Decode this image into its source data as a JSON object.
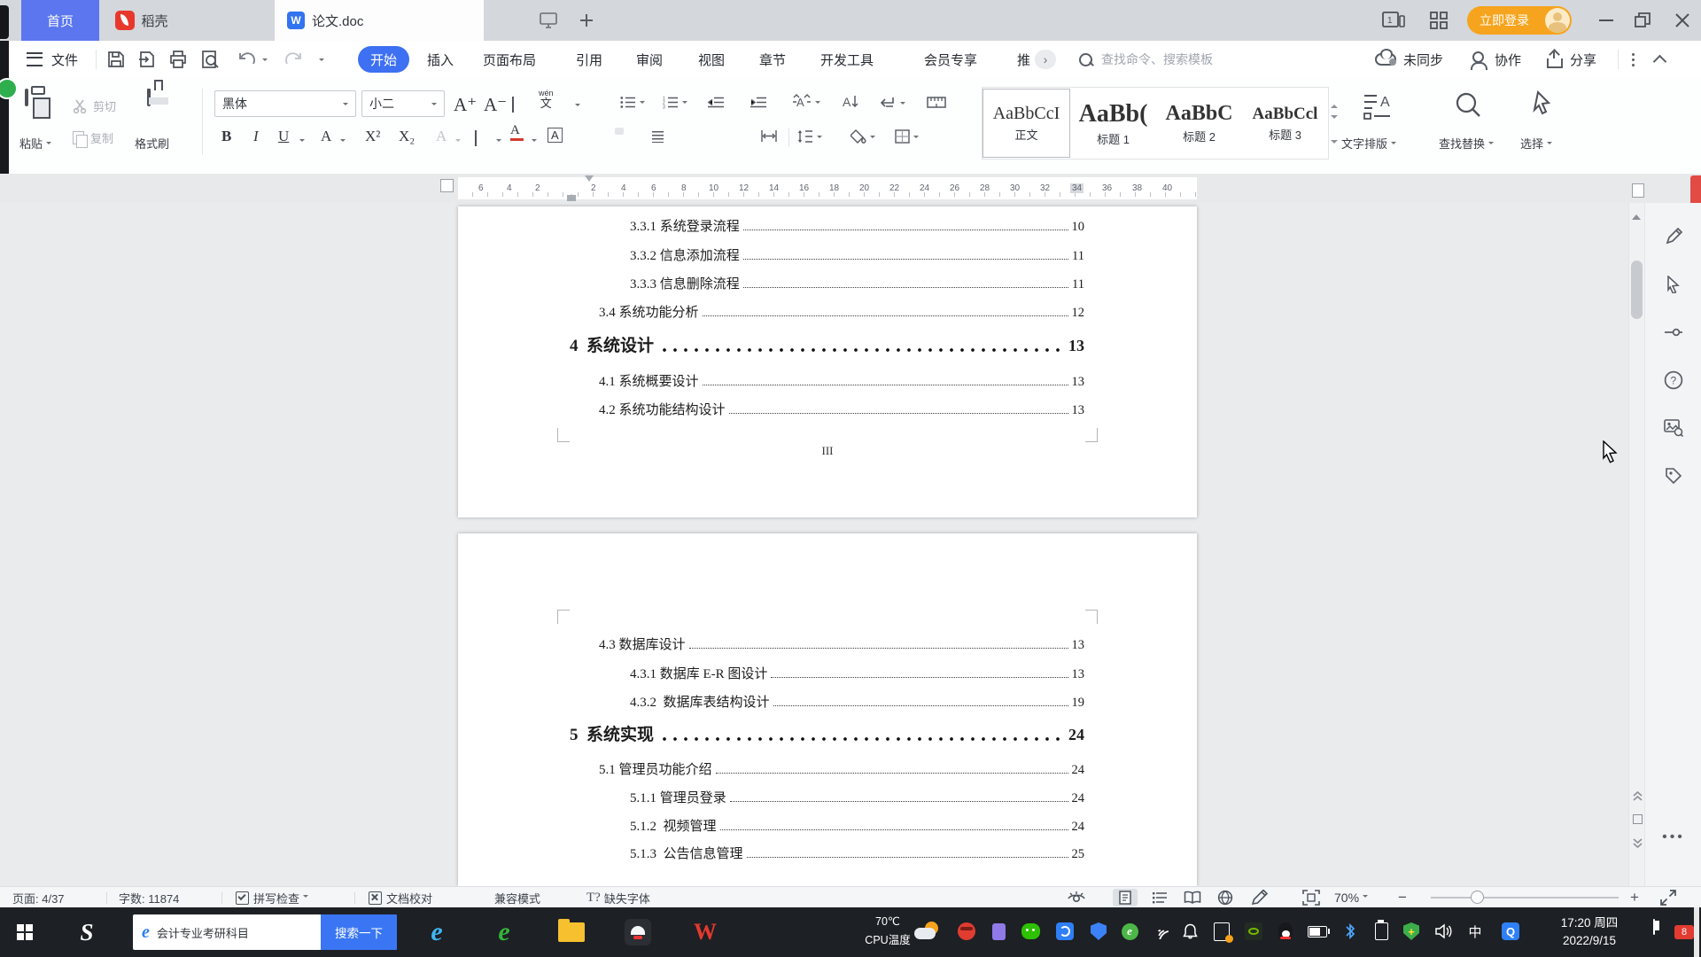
{
  "titlebar": {
    "tab_home": "首页",
    "tab_docer": "稻壳",
    "tab_doc": "论文.doc",
    "login": "立即登录"
  },
  "menubar": {
    "file": "文件",
    "tabs": [
      "开始",
      "插入",
      "页面布局",
      "引用",
      "审阅",
      "视图",
      "章节",
      "开发工具",
      "会员专享",
      "推"
    ],
    "more": "›",
    "search_placeholder": "查找命令、搜索模板",
    "sync": "未同步",
    "collab": "协作",
    "share": "分享"
  },
  "ribbon": {
    "paste": "粘贴",
    "cut": "剪切",
    "copy": "复制",
    "painter": "格式刷",
    "font_name": "黑体",
    "font_size": "小二",
    "bold": "B",
    "italic": "I",
    "underline": "U",
    "accent": "A",
    "sup": "X²",
    "sub": "X₂",
    "effect": "A",
    "fontcolor": "A",
    "charborder": "A",
    "grow": "A⁺",
    "shrink": "A⁻",
    "wen_pinyin": "wén",
    "wen_char": "文",
    "textdir": "A",
    "styles": [
      {
        "sample": "AaBbCcI",
        "label": "正文"
      },
      {
        "sample": "AaBb(",
        "label": "标题 1"
      },
      {
        "sample": "AaBbC",
        "label": "标题 2"
      },
      {
        "sample": "AaBbCcl",
        "label": "标题 3"
      }
    ],
    "text_layout": "文字排版",
    "find_replace": "查找替换",
    "select_tool": "选择"
  },
  "ruler": {
    "numbers": [
      "6",
      "4",
      "2",
      "2",
      "4",
      "6",
      "8",
      "10",
      "12",
      "14",
      "16",
      "18",
      "20",
      "22",
      "24",
      "26",
      "28",
      "30",
      "32",
      "34",
      "36",
      "38",
      "40"
    ]
  },
  "document": {
    "page1": {
      "entries": [
        {
          "text": "3.3.1 系统登录流程",
          "page": "10"
        },
        {
          "text": "3.3.2 信息添加流程",
          "page": "11"
        },
        {
          "text": "3.3.3 信息删除流程",
          "page": "11"
        },
        {
          "text": "3.4 系统功能分析",
          "page": "12"
        },
        {
          "text": "4  系统设计",
          "page": "13"
        },
        {
          "text": "4.1 系统概要设计",
          "page": "13"
        },
        {
          "text": "4.2 系统功能结构设计",
          "page": "13"
        }
      ],
      "footer": "III"
    },
    "page2": {
      "entries": [
        {
          "text": "4.3 数据库设计",
          "page": "13"
        },
        {
          "text": "4.3.1 数据库 E-R 图设计",
          "page": "13"
        },
        {
          "text": "4.3.2  数据库表结构设计",
          "page": "19"
        },
        {
          "text": "5  系统实现",
          "page": "24"
        },
        {
          "text": "5.1 管理员功能介绍",
          "page": "24"
        },
        {
          "text": "5.1.1 管理员登录",
          "page": "24"
        },
        {
          "text": "5.1.2  视频管理",
          "page": "24"
        },
        {
          "text": "5.1.3  公告信息管理",
          "page": "25"
        }
      ]
    }
  },
  "statusbar": {
    "page": "页面: 4/37",
    "words": "字数: 11874",
    "spell": "拼写检查",
    "proof": "文档校对",
    "compat": "兼容模式",
    "missing_font": "缺失字体",
    "zoom": "70%"
  },
  "taskbar": {
    "search_text": "会计专业考研科目",
    "search_button": "搜索一下",
    "cpu_temp": "70℃",
    "cpu_label": "CPU温度",
    "time": "17:20 周四",
    "date": "2022/9/15",
    "ime": "中",
    "badge": "8"
  }
}
